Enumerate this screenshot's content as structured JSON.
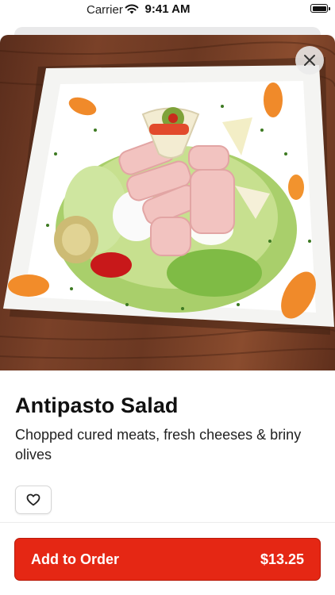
{
  "status_bar": {
    "carrier": "Carrier",
    "time": "9:41 AM",
    "wifi_icon": "wifi-icon",
    "battery_icon": "battery-icon"
  },
  "item": {
    "name": "Antipasto Salad",
    "description": "Chopped cured meats, fresh cheeses & briny olives",
    "photo_icon": "food-photo"
  },
  "actions": {
    "close_icon": "close-icon",
    "favorite_icon": "heart-icon",
    "add_label": "Add to Order",
    "price": "$13.25"
  },
  "colors": {
    "accent": "#e52714",
    "table_wood": "#6b3822",
    "plate": "#f4f4f2"
  }
}
